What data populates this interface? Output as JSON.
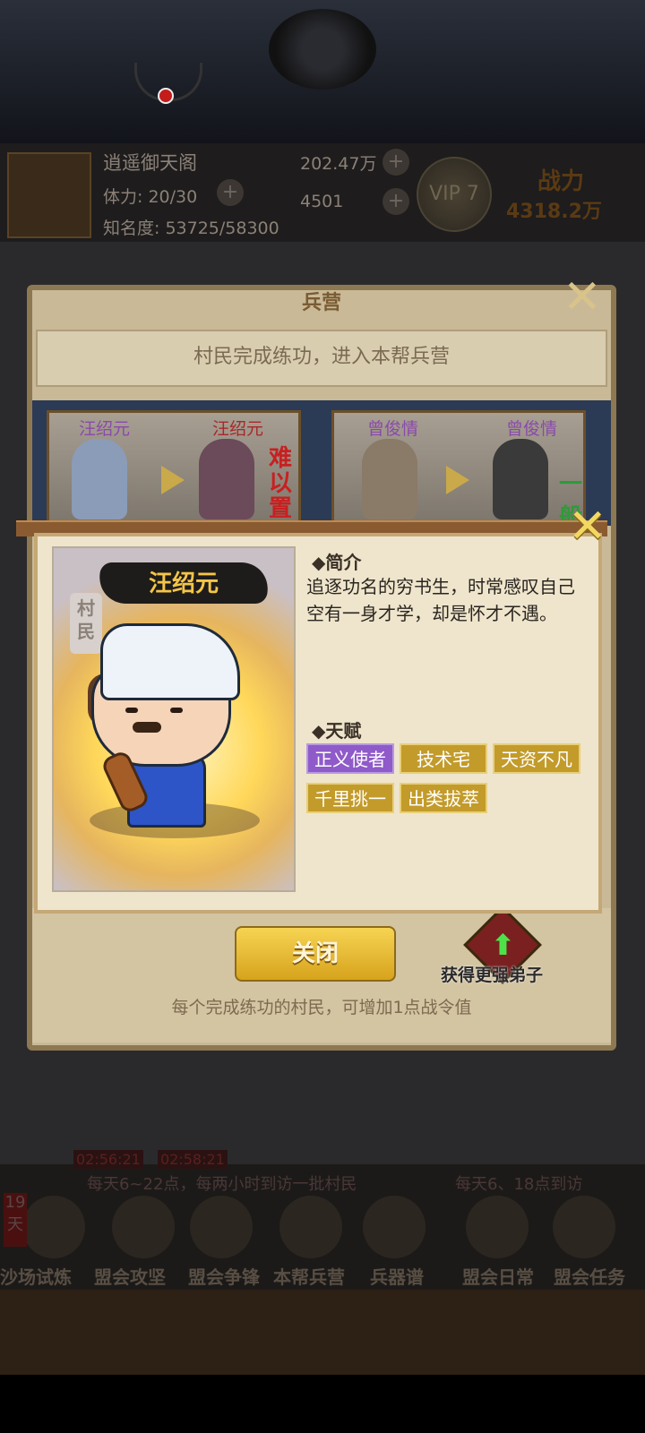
{
  "hud": {
    "guild_name": "逍遥御天阁",
    "stamina": "体力: 20/30",
    "fame": "知名度: 53725/58300",
    "silver": "202.47万",
    "gold": "4501",
    "vip_level": "VIP 7",
    "power_label": "战力",
    "power_value": "4318.2万"
  },
  "bottom_nav": {
    "items": [
      "沙场试炼",
      "盟会攻坚",
      "盟会争锋",
      "本帮兵营",
      "兵器谱",
      "盟会日常",
      "盟会任务"
    ],
    "badge_days": "19天"
  },
  "behind": {
    "left_hint": "每天6~22点，每两小时到访一批村民",
    "right_hint": "每天6、18点到访",
    "timers": [
      "02:56:21",
      "02:58:21"
    ]
  },
  "barracks": {
    "title": "兵营",
    "banner": "村民完成练功，进入本帮兵营",
    "cards": [
      {
        "from_name": "汪绍元",
        "to_name": "汪绍元",
        "tag": "难以置信"
      },
      {
        "from_name": "曾俊情",
        "to_name": "曾俊情",
        "tag": "一般"
      }
    ],
    "close_label": "关闭",
    "better_label": "获得更强弟子",
    "footer_hint": "每个完成练功的村民，可增加1点战令值"
  },
  "detail": {
    "portrait_name": "汪绍元",
    "portrait_type": "村民",
    "intro_title": "◆简介",
    "intro_text": "追逐功名的穷书生，时常感叹自己空有一身才学，却是怀才不遇。",
    "talent_title": "◆天赋",
    "talents": [
      "正义使者",
      "技术宅",
      "天资不凡",
      "千里挑一",
      "出类拔萃"
    ]
  },
  "colors": {
    "talent_purple": "#8f5ac9",
    "talent_gold": "#c39b2a",
    "close_button": "#f0c63d"
  }
}
